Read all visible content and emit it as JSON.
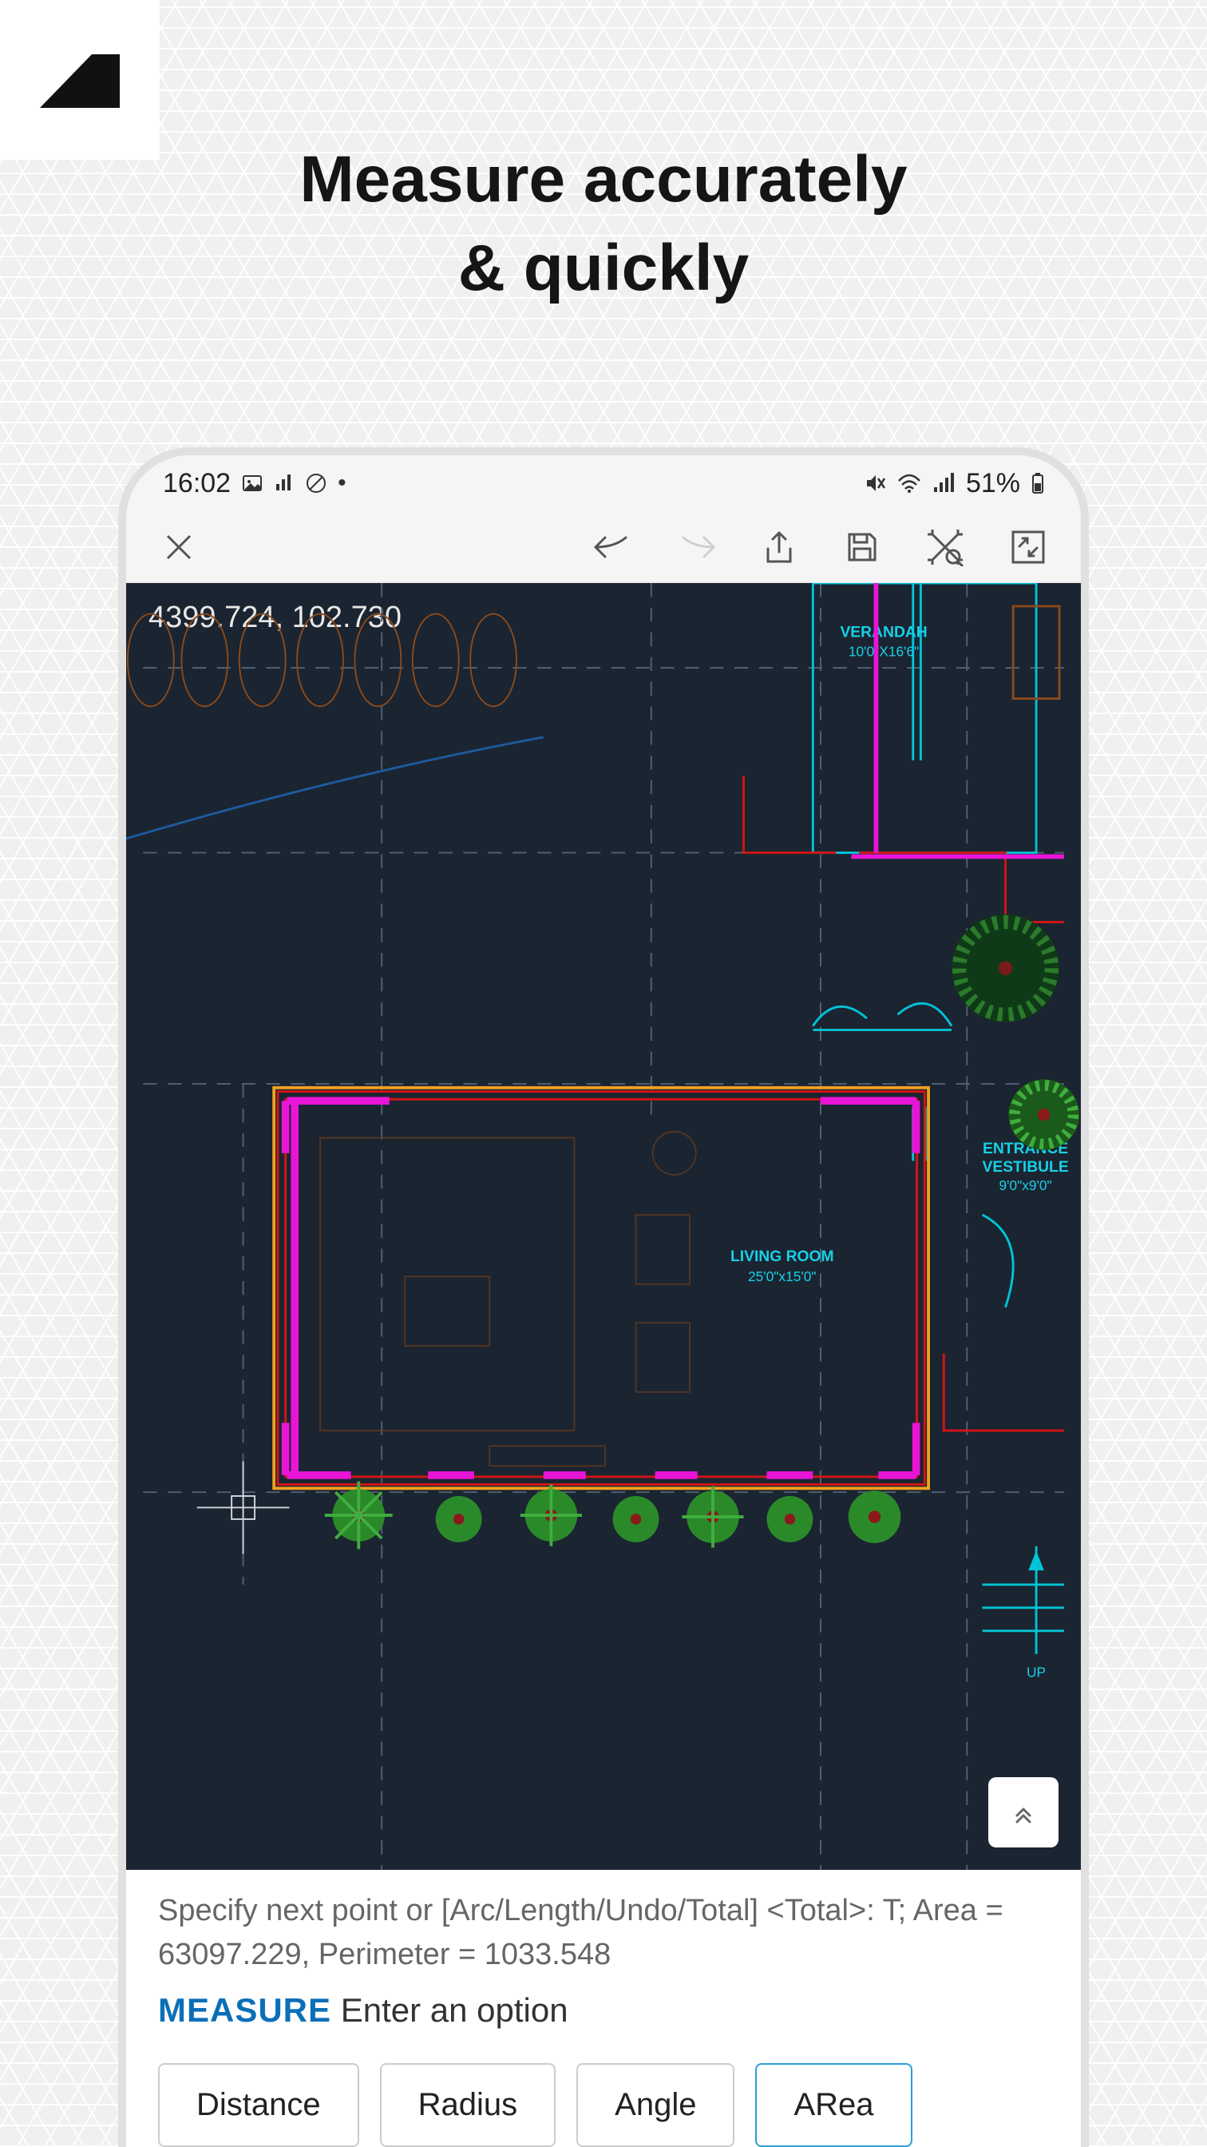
{
  "headline_line1": "Measure accurately",
  "headline_line2": "& quickly",
  "status": {
    "time": "16:02",
    "battery": "51%"
  },
  "canvas": {
    "coords": "4399.724, 102.730",
    "rooms": {
      "living": {
        "name": "LIVING ROOM",
        "dim": "25'0\"x15'0\""
      },
      "verandah": {
        "name": "VERANDAH",
        "dim": "10'0\"X16'6\""
      },
      "entrance": {
        "name": "ENTRANCE",
        "name2": "VESTIBULE",
        "dim": "9'0\"x9'0\""
      },
      "up": "UP"
    }
  },
  "console": {
    "log": "Specify next point or [Arc/Length/Undo/Total] <Total>: T; Area = 63097.229, Perimeter = 1033.548",
    "command": "MEASURE",
    "prompt": "Enter an option"
  },
  "options": {
    "distance": "Distance",
    "radius": "Radius",
    "angle": "Angle",
    "area": "ARea"
  }
}
